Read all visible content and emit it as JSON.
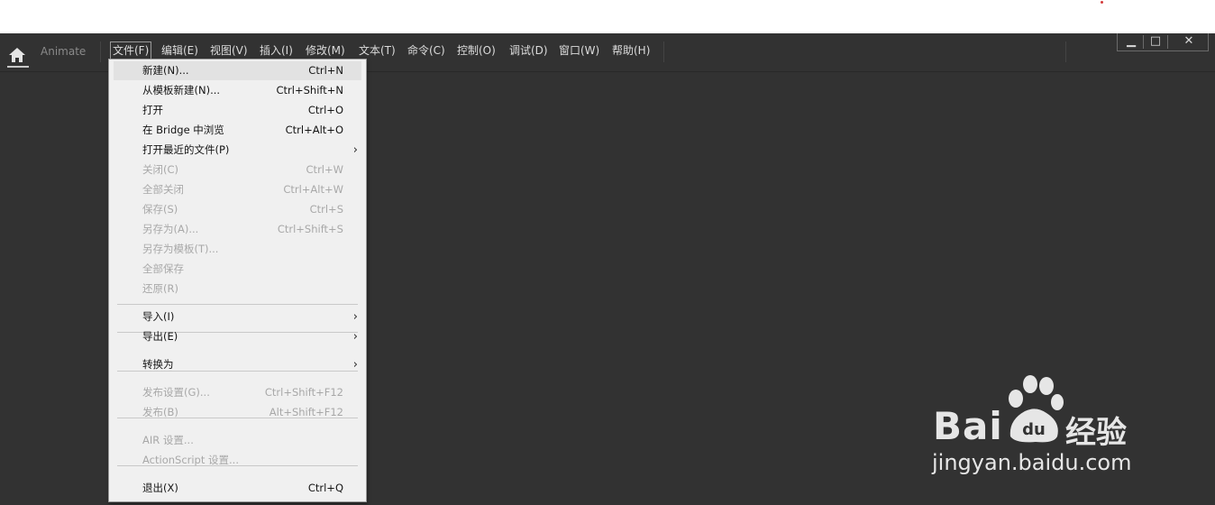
{
  "app": {
    "name": "Animate"
  },
  "menubar": [
    {
      "label": "文件(F)",
      "active": true
    },
    {
      "label": "编辑(E)"
    },
    {
      "label": "视图(V)"
    },
    {
      "label": "插入(I)"
    },
    {
      "label": "修改(M)"
    },
    {
      "label": "文本(T)"
    },
    {
      "label": "命令(C)"
    },
    {
      "label": "控制(O)"
    },
    {
      "label": "调试(D)"
    },
    {
      "label": "窗口(W)"
    },
    {
      "label": "帮助(H)"
    }
  ],
  "window_controls": {
    "minimize": "▁",
    "maximize": "□",
    "close": "✕"
  },
  "file_menu": [
    {
      "label": "新建(N)...",
      "shortcut": "Ctrl+N"
    },
    {
      "label": "从模板新建(N)...",
      "shortcut": "Ctrl+Shift+N"
    },
    {
      "label": "打开",
      "shortcut": "Ctrl+O"
    },
    {
      "label": "在 Bridge 中浏览",
      "shortcut": "Ctrl+Alt+O"
    },
    {
      "label": "打开最近的文件(P)",
      "shortcut": "",
      "submenu": true
    },
    {
      "label": "关闭(C)",
      "shortcut": "Ctrl+W",
      "disabled": true
    },
    {
      "label": "全部关闭",
      "shortcut": "Ctrl+Alt+W",
      "disabled": true
    },
    {
      "label": "保存(S)",
      "shortcut": "Ctrl+S",
      "disabled": true
    },
    {
      "label": "另存为(A)...",
      "shortcut": "Ctrl+Shift+S",
      "disabled": true
    },
    {
      "label": "另存为模板(T)...",
      "shortcut": "",
      "disabled": true
    },
    {
      "label": "全部保存",
      "shortcut": "",
      "disabled": true
    },
    {
      "label": "还原(R)",
      "shortcut": "",
      "disabled": true
    },
    {
      "label": "导入(I)",
      "shortcut": "",
      "submenu": true
    },
    {
      "label": "导出(E)",
      "shortcut": "",
      "submenu": true
    },
    {
      "label": "转换为",
      "shortcut": "",
      "submenu": true
    },
    {
      "label": "发布设置(G)...",
      "shortcut": "Ctrl+Shift+F12",
      "disabled": true
    },
    {
      "label": "发布(B)",
      "shortcut": "Alt+Shift+F12",
      "disabled": true
    },
    {
      "label": "AIR 设置...",
      "shortcut": "",
      "disabled": true
    },
    {
      "label": "ActionScript 设置...",
      "shortcut": "",
      "disabled": true
    },
    {
      "label": "退出(X)",
      "shortcut": "Ctrl+Q"
    }
  ],
  "submenu_arrow": "›",
  "watermark": {
    "brand": "Bai",
    "brand2": "du",
    "cn": "经验",
    "url": "jingyan.baidu.com"
  },
  "colors": {
    "app_bg": "#323232",
    "menu_bg": "#f0f0f0",
    "disabled": "#a8a8a8",
    "accent_dot": "#d43b3b"
  },
  "icons": {
    "home": "home-icon",
    "submenu": "chevron-right-icon"
  }
}
